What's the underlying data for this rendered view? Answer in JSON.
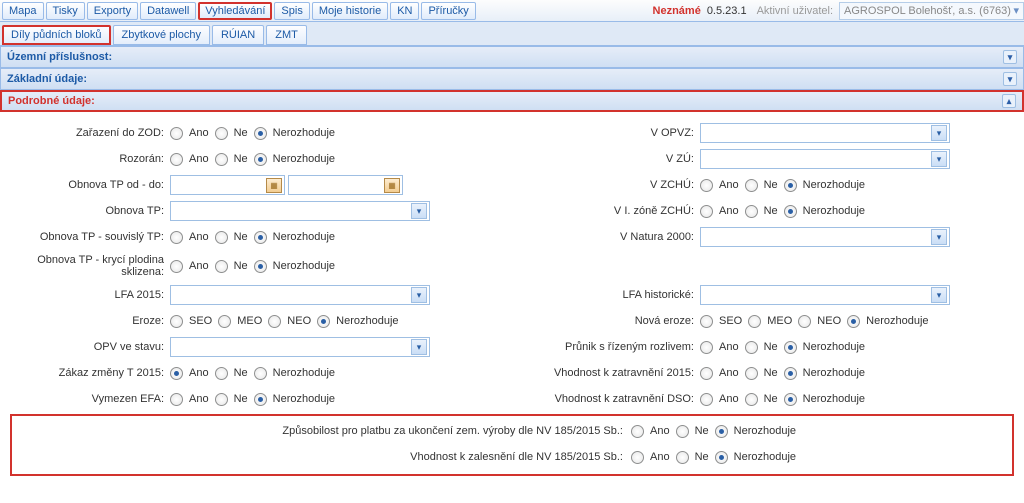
{
  "topbar": {
    "tabs": [
      "Mapa",
      "Tisky",
      "Exporty",
      "Datawell",
      "Vyhledávání",
      "Spis",
      "Moje historie",
      "KN",
      "Příručky"
    ],
    "active": 4,
    "status": "Neznámé",
    "version": "0.5.23.1",
    "userLabel": "Aktivní uživatel:",
    "userValue": "AGROSPOL Bolehošť, a.s. (6763)"
  },
  "subtabs": {
    "tabs": [
      "Díly půdních bloků",
      "Zbytkové plochy",
      "RÚIAN",
      "ZMT"
    ],
    "active": 0
  },
  "sections": {
    "s1": "Územní příslušnost:",
    "s2": "Základní údaje:",
    "s3": "Podrobné údaje:"
  },
  "opts3": {
    "a": "Ano",
    "n": "Ne",
    "x": "Nerozhoduje"
  },
  "eroze": {
    "seo": "SEO",
    "meo": "MEO",
    "neo": "NEO",
    "x": "Nerozhoduje"
  },
  "left": {
    "zod": "Zařazení do ZOD:",
    "rozoran": "Rozorán:",
    "obnovaOdDo": "Obnova TP od - do:",
    "obnovaTp": "Obnova TP:",
    "souvisly": "Obnova TP - souvislý TP:",
    "kryci": "Obnova TP - krycí plodina sklizena:",
    "lfa2015": "LFA 2015:",
    "erozeLbl": "Eroze:",
    "opv": "OPV ve stavu:",
    "zakaz": "Zákaz změny T 2015:",
    "efa": "Vymezen EFA:"
  },
  "right": {
    "vopvz": "V OPVZ:",
    "vzu": "V ZÚ:",
    "vzchu": "V ZCHÚ:",
    "vizone": "V I. zóně ZCHÚ:",
    "natura": "V Natura 2000:",
    "lfaHist": "LFA historické:",
    "novaEroze": "Nová eroze:",
    "prunik": "Průnik s řízeným rozlivem:",
    "vhod2015": "Vhodnost k zatravnění 2015:",
    "vhodDso": "Vhodnost k zatravnění DSO:"
  },
  "bottom": {
    "zpusobilost": "Způsobilost pro platbu za ukončení zem. výroby dle NV 185/2015 Sb.:",
    "zalesneni": "Vhodnost k zalesnění dle NV 185/2015 Sb.:"
  }
}
